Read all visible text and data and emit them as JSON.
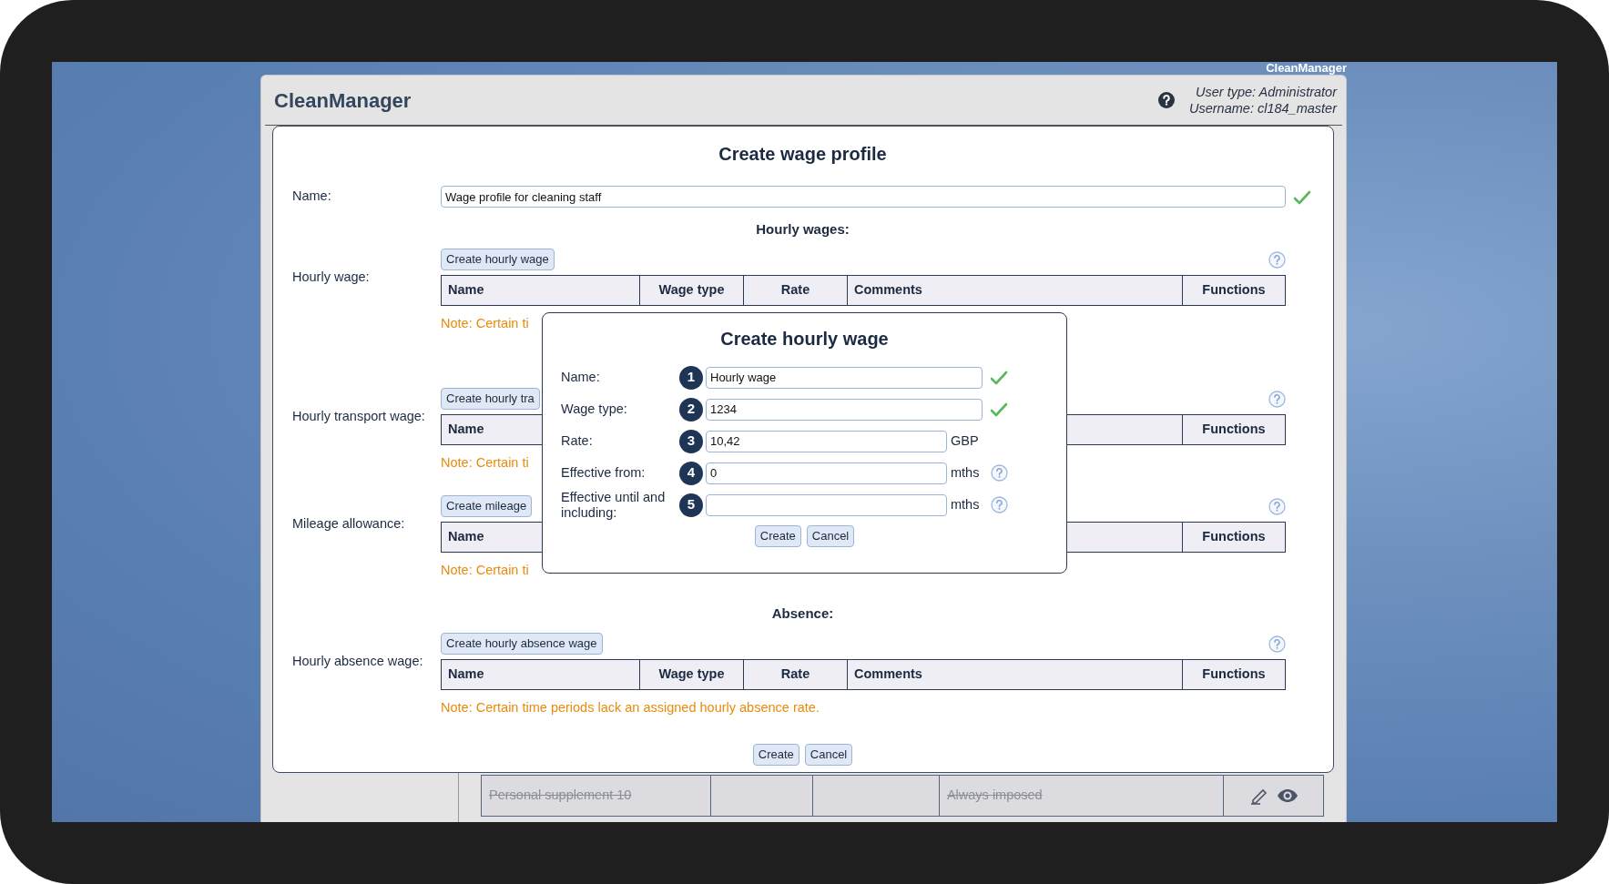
{
  "window_label": "CleanManager",
  "app": {
    "title": "CleanManager",
    "user_type": "User type: Administrator",
    "username": "Username: cl184_master"
  },
  "dialog": {
    "title": "Create wage profile",
    "name_label": "Name:",
    "name_value": "Wage profile for cleaning staff",
    "name_valid": true,
    "groups": [
      {
        "heading": "Hourly wages:",
        "sections": [
          {
            "label": "Hourly wage:",
            "button": "Create hourly wage",
            "columns": [
              "Name",
              "Wage type",
              "Rate",
              "Comments",
              "Functions"
            ],
            "note": "Note: Certain ti"
          },
          {
            "label": "Hourly transport wage:",
            "button": "Create hourly tra",
            "columns": [
              "Name",
              "Functions"
            ],
            "note": "Note: Certain ti"
          },
          {
            "label": "Mileage allowance:",
            "button": "Create mileage",
            "columns": [
              "Name",
              "Functions"
            ],
            "note": "Note: Certain ti"
          }
        ]
      },
      {
        "heading": "Absence:",
        "sections": [
          {
            "label": "Hourly absence wage:",
            "button": "Create hourly absence wage",
            "columns": [
              "Name",
              "Wage type",
              "Rate",
              "Comments",
              "Functions"
            ],
            "note": "Note: Certain time periods lack an assigned hourly absence rate."
          }
        ]
      }
    ],
    "buttons": [
      "Create",
      "Cancel"
    ]
  },
  "modal": {
    "title": "Create hourly wage",
    "fields": [
      {
        "label": "Name:",
        "step": "1",
        "value": "Hourly wage",
        "valid": true
      },
      {
        "label": "Wage type:",
        "step": "2",
        "value": "1234",
        "valid": true
      },
      {
        "label": "Rate:",
        "step": "3",
        "value": "10,42",
        "unit": "GBP"
      },
      {
        "label": "Effective from:",
        "step": "4",
        "value": "0",
        "unit": "mths",
        "help": true
      },
      {
        "label": "Effective until and including:",
        "step": "5",
        "unit": "mths",
        "help": true
      }
    ],
    "buttons": [
      "Create",
      "Cancel"
    ]
  },
  "background_row": {
    "inactive": true,
    "column_1": "Personal supplement 10",
    "column_4": "Always imposed"
  }
}
